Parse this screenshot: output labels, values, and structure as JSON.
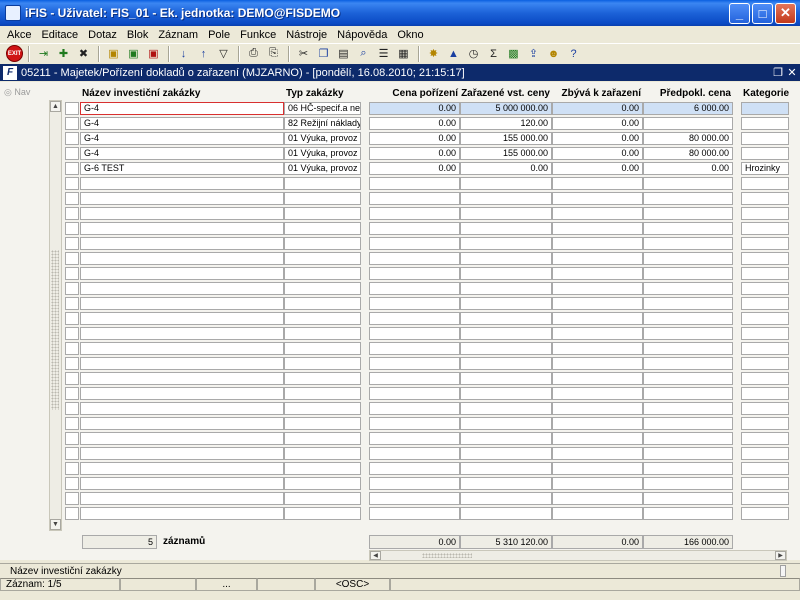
{
  "window": {
    "title": "iFIS - Uživatel: FIS_01 - Ek. jednotka: DEMO@FISDEMO",
    "minimize_glyph": "_",
    "maximize_glyph": "□",
    "close_glyph": "✕"
  },
  "menu": [
    "Akce",
    "Editace",
    "Dotaz",
    "Blok",
    "Záznam",
    "Pole",
    "Funkce",
    "Nástroje",
    "Nápověda",
    "Okno"
  ],
  "toolbar": {
    "exit_label": "EXIT",
    "buttons": [
      {
        "name": "enter-icon",
        "glyph": "⇥",
        "color": "g"
      },
      {
        "name": "new-record-icon",
        "glyph": "✚",
        "color": "g"
      },
      {
        "name": "delete-record-icon",
        "glyph": "✖",
        "color": "k"
      },
      {
        "name": "save-icon",
        "glyph": "▣",
        "color": "y"
      },
      {
        "name": "save-next-icon",
        "glyph": "▣",
        "color": "g"
      },
      {
        "name": "cancel-icon",
        "glyph": "▣",
        "color": "r"
      },
      {
        "name": "sort-asc-icon",
        "glyph": "↓",
        "color": "b"
      },
      {
        "name": "sort-desc-icon",
        "glyph": "↑",
        "color": "b"
      },
      {
        "name": "filter-icon",
        "glyph": "▽",
        "color": "k"
      },
      {
        "name": "print-icon",
        "glyph": "⎙",
        "color": "k"
      },
      {
        "name": "print-preview-icon",
        "glyph": "⎘",
        "color": "k"
      },
      {
        "name": "cut-icon",
        "glyph": "✂",
        "color": "k"
      },
      {
        "name": "copy-icon",
        "glyph": "❐",
        "color": "b"
      },
      {
        "name": "paste-icon",
        "glyph": "▤",
        "color": "k"
      },
      {
        "name": "find-icon",
        "glyph": "⌕",
        "color": "b"
      },
      {
        "name": "list-icon",
        "glyph": "☰",
        "color": "k"
      },
      {
        "name": "calculator-icon",
        "glyph": "▦",
        "color": "k"
      },
      {
        "name": "settings-icon",
        "glyph": "✸",
        "color": "y"
      },
      {
        "name": "chart-icon",
        "glyph": "▲",
        "color": "b"
      },
      {
        "name": "clock-icon",
        "glyph": "◷",
        "color": "k"
      },
      {
        "name": "sum-icon",
        "glyph": "Σ",
        "color": "k"
      },
      {
        "name": "excel-icon",
        "glyph": "▩",
        "color": "g"
      },
      {
        "name": "export-icon",
        "glyph": "⇪",
        "color": "b"
      },
      {
        "name": "user-help-icon",
        "glyph": "☻",
        "color": "y"
      },
      {
        "name": "help-icon",
        "glyph": "?",
        "color": "b"
      }
    ]
  },
  "form": {
    "icon_letter": "F",
    "title": "05211 - Majetek/Pořízení dokladů o zařazení (MJZARNO) - [pondělí, 16.08.2010; 21:15:17]",
    "restore_glyph": "❐",
    "close_glyph": "✕",
    "nav_label": "Nav"
  },
  "columns": {
    "name": "Název investiční zakázky",
    "type": "Typ zakázky",
    "cost": "Cena pořízení",
    "entered": "Zařazené vst. ceny",
    "remaining": "Zbývá k zařazení",
    "expected": "Předpokl. cena",
    "category": "Kategorie"
  },
  "rows": [
    {
      "name": "G-4",
      "type": "06 HČ-specif.a nesp",
      "cost": "0.00",
      "entered": "5 000 000.00",
      "remaining": "0.00",
      "expected": "6 000.00",
      "category": ""
    },
    {
      "name": "G-4",
      "type": "82 Režijní náklady",
      "cost": "0.00",
      "entered": "120.00",
      "remaining": "0.00",
      "expected": "",
      "category": ""
    },
    {
      "name": "G-4",
      "type": "01 Výuka, provoz (c",
      "cost": "0.00",
      "entered": "155 000.00",
      "remaining": "0.00",
      "expected": "80 000.00",
      "category": ""
    },
    {
      "name": "G-4",
      "type": "01 Výuka, provoz (c",
      "cost": "0.00",
      "entered": "155 000.00",
      "remaining": "0.00",
      "expected": "80 000.00",
      "category": ""
    },
    {
      "name": "G-6 TEST",
      "type": "01 Výuka, provoz (c",
      "cost": "0.00",
      "entered": "0.00",
      "remaining": "0.00",
      "expected": "0.00",
      "category": "Hrozinky"
    }
  ],
  "summary": {
    "count": "5",
    "count_label": "záznamů",
    "cost": "0.00",
    "entered": "5 310 120.00",
    "remaining": "0.00",
    "expected": "166 000.00"
  },
  "hint": "Název investiční zakázky",
  "status": {
    "record": "Záznam: 1/5",
    "ellipsis": "...",
    "osc": "<OSC>"
  },
  "colors": {
    "titlebar": "#1c62d8",
    "form_header": "#0d2a6b",
    "row_highlight": "#cfe0f5",
    "current_cell_border": "#d83030"
  }
}
